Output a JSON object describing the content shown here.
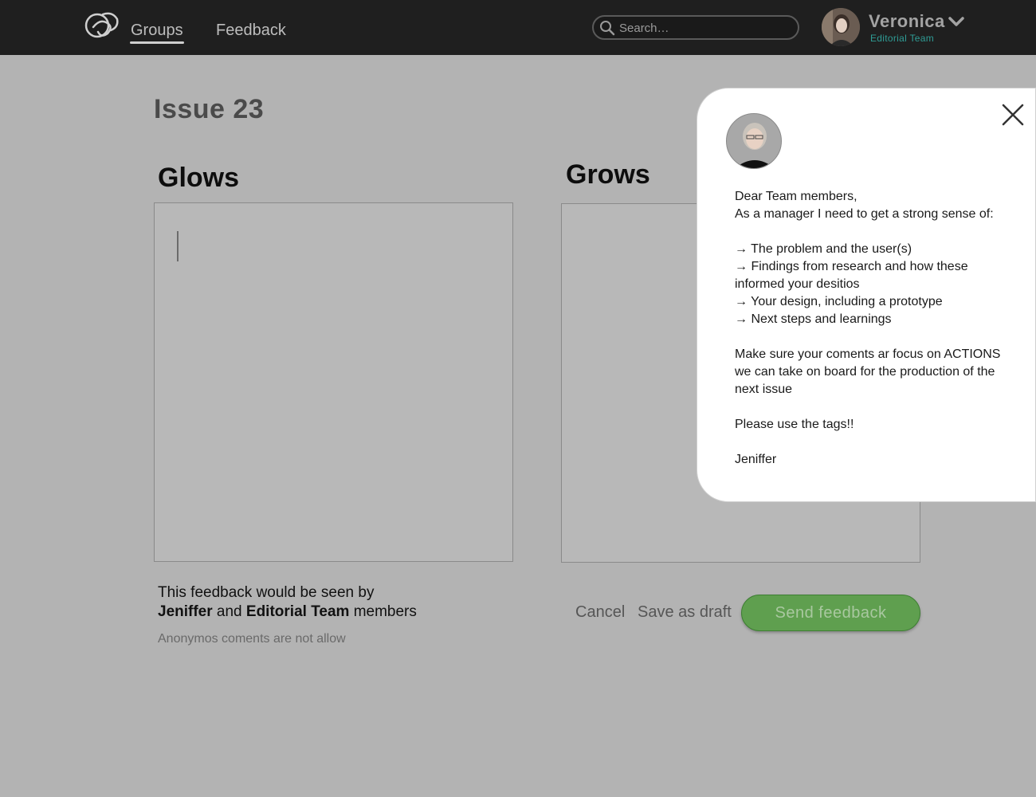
{
  "nav": {
    "tabs": [
      {
        "label": "Groups",
        "active": true
      },
      {
        "label": "Feedback",
        "active": false
      }
    ],
    "search": {
      "placeholder": "Search…"
    },
    "user": {
      "name": "Veronica",
      "team": "Editorial Team",
      "icon": "chevron-down-icon"
    }
  },
  "main": {
    "issue_title": "Issue 23",
    "glows_heading": "Glows",
    "grows_heading": "Grows",
    "visibility": {
      "prefix": "This feedback would be seen by",
      "person": "Jeniffer",
      "and": "and",
      "group": "Editorial Team",
      "suffix": "members"
    },
    "anon_note": "Anonymos coments are not allow",
    "actions": {
      "cancel": "Cancel",
      "save_draft": "Save as draft",
      "send": "Send feedback"
    }
  },
  "popup": {
    "greeting": "Dear Team members,",
    "intro": "As a manager I need to get a strong sense of:",
    "points": [
      "→ The problem and the user(s)",
      "→ Findings from research and how these informed your desitios",
      "→ Your design, including a prototype",
      "→ Next steps and learnings"
    ],
    "focus": "Make sure your coments ar focus on ACTIONS we can take on board for the production of the next issue",
    "tags": "Please use the tags!!",
    "signature": "Jeniffer"
  },
  "colors": {
    "topbar": "#1f1f1f",
    "page_bg": "#b3b3b3",
    "team_accent": "#2f9c95",
    "send_button": "#5f9f4f"
  }
}
